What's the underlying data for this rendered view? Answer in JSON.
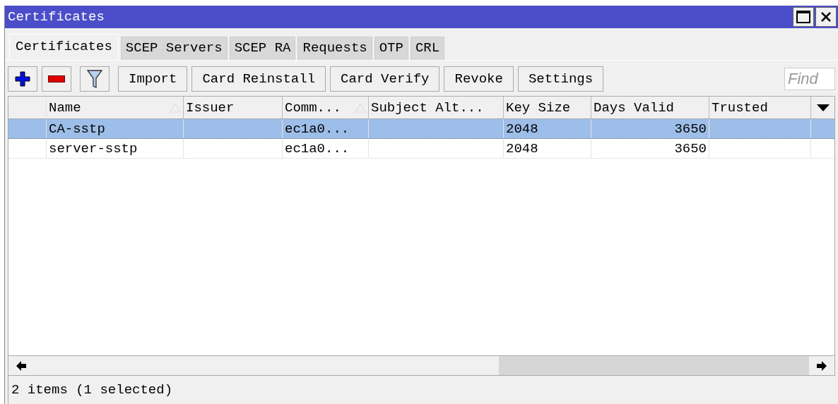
{
  "window": {
    "title": "Certificates"
  },
  "tabs": [
    {
      "label": "Certificates",
      "selected": true
    },
    {
      "label": "SCEP Servers",
      "selected": false
    },
    {
      "label": "SCEP RA",
      "selected": false
    },
    {
      "label": "Requests",
      "selected": false
    },
    {
      "label": "OTP",
      "selected": false
    },
    {
      "label": "CRL",
      "selected": false
    }
  ],
  "toolbar": {
    "icon_buttons": [
      {
        "kind": "add"
      },
      {
        "kind": "remove"
      },
      {
        "kind": "filter"
      }
    ],
    "buttons": [
      "Import",
      "Card Reinstall",
      "Card Verify",
      "Revoke",
      "Settings"
    ],
    "search": {
      "placeholder": "Find"
    }
  },
  "table": {
    "columns": [
      {
        "label": "Name",
        "sorted": true,
        "kind": "text"
      },
      {
        "label": "Issuer",
        "sorted": false,
        "kind": "text"
      },
      {
        "label": "Comm...",
        "sorted": true,
        "kind": "text"
      },
      {
        "label": "Subject Alt...",
        "sorted": false,
        "kind": "text"
      },
      {
        "label": "Key Size",
        "sorted": false,
        "kind": "text"
      },
      {
        "label": "Days Valid",
        "sorted": false,
        "kind": "number"
      },
      {
        "label": "Trusted",
        "sorted": false,
        "kind": "text"
      }
    ],
    "rows": [
      {
        "selected": true,
        "cells": [
          "CA-sstp",
          "",
          "ec1a0...",
          "",
          "2048",
          "3650",
          ""
        ]
      },
      {
        "selected": false,
        "cells": [
          "server-sstp",
          "",
          "ec1a0...",
          "",
          "2048",
          "3650",
          ""
        ]
      }
    ]
  },
  "status_bar": "2 items (1 selected)"
}
